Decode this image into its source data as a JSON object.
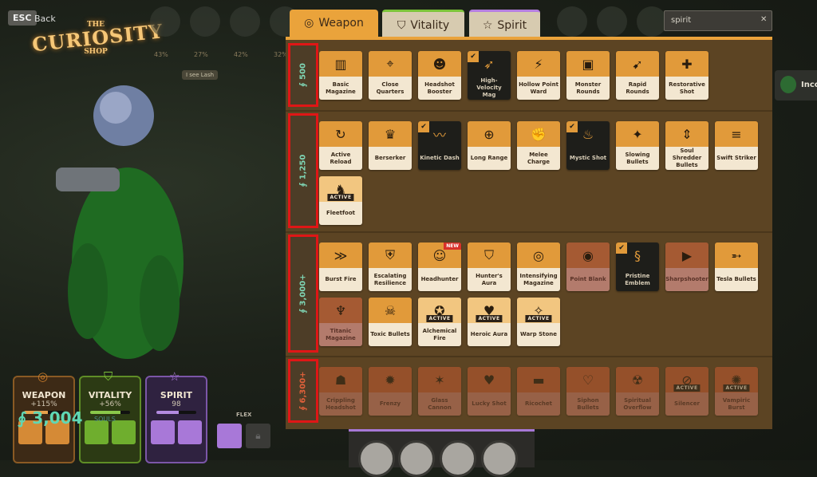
{
  "header": {
    "esc_key": "ESC",
    "back_label": "Back",
    "logo": {
      "the": "THE",
      "name": "CURIOSITY",
      "shop": "SHOP"
    },
    "portrait_percents": [
      "43%",
      "27%",
      "42%",
      "32%"
    ],
    "ping_label": "I see Lash"
  },
  "tabs": [
    {
      "label": "Weapon",
      "icon": "weapon-icon",
      "active": true
    },
    {
      "label": "Vitality",
      "icon": "vitality-icon",
      "active": false
    },
    {
      "label": "Spirit",
      "icon": "spirit-icon",
      "active": false
    }
  ],
  "search": {
    "value": "spirit",
    "clear_icon": "close-icon"
  },
  "notification": {
    "text": "Inco"
  },
  "tiers": [
    {
      "price": "500",
      "locked": false,
      "items": [
        {
          "name": "Basic Magazine",
          "icon": "▥"
        },
        {
          "name": "Close Quarters",
          "icon": "⌖"
        },
        {
          "name": "Headshot Booster",
          "icon": "☻"
        },
        {
          "name": "High-Velocity Mag",
          "icon": "➶",
          "owned": true
        },
        {
          "name": "Hollow Point Ward",
          "icon": "⚡"
        },
        {
          "name": "Monster Rounds",
          "icon": "▣"
        },
        {
          "name": "Rapid Rounds",
          "icon": "➹"
        },
        {
          "name": "Restorative Shot",
          "icon": "✚"
        }
      ]
    },
    {
      "price": "1,250",
      "locked": false,
      "items": [
        {
          "name": "Active Reload",
          "icon": "↻"
        },
        {
          "name": "Berserker",
          "icon": "♛"
        },
        {
          "name": "Kinetic Dash",
          "icon": "〰",
          "owned": true
        },
        {
          "name": "Long Range",
          "icon": "⊕"
        },
        {
          "name": "Melee Charge",
          "icon": "✊"
        },
        {
          "name": "Mystic Shot",
          "icon": "♨",
          "owned": true
        },
        {
          "name": "Slowing Bullets",
          "icon": "✦"
        },
        {
          "name": "Soul Shredder Bullets",
          "icon": "⇕"
        },
        {
          "name": "Swift Striker",
          "icon": "≡"
        },
        {
          "name": "Fleetfoot",
          "icon": "♞",
          "active": true,
          "light": true
        }
      ]
    },
    {
      "price": "3,000+",
      "locked": false,
      "items": [
        {
          "name": "Burst Fire",
          "icon": "≫"
        },
        {
          "name": "Escalating Resilience",
          "icon": "⛨"
        },
        {
          "name": "Headhunter",
          "icon": "☺",
          "new": true
        },
        {
          "name": "Hunter's Aura",
          "icon": "⛉"
        },
        {
          "name": "Intensifying Magazine",
          "icon": "◎"
        },
        {
          "name": "Point Blank",
          "icon": "◉",
          "disabled": true
        },
        {
          "name": "Pristine Emblem",
          "icon": "§",
          "owned": true
        },
        {
          "name": "Sharpshooter",
          "icon": "▶",
          "disabled": true
        },
        {
          "name": "Tesla Bullets",
          "icon": "➵"
        },
        {
          "name": "Titanic Magazine",
          "icon": "♆",
          "disabled": true
        },
        {
          "name": "Toxic Bullets",
          "icon": "☠"
        },
        {
          "name": "Alchemical Fire",
          "icon": "✪",
          "active": true,
          "light": true
        },
        {
          "name": "Heroic Aura",
          "icon": "♥",
          "active": true,
          "light": true
        },
        {
          "name": "Warp Stone",
          "icon": "✧",
          "active": true,
          "light": true
        }
      ]
    },
    {
      "price": "6,300+",
      "locked": true,
      "items": [
        {
          "name": "Crippling Headshot",
          "icon": "☗"
        },
        {
          "name": "Frenzy",
          "icon": "✹"
        },
        {
          "name": "Glass Cannon",
          "icon": "✶"
        },
        {
          "name": "Lucky Shot",
          "icon": "♥"
        },
        {
          "name": "Ricochet",
          "icon": "▬"
        },
        {
          "name": "Siphon Bullets",
          "icon": "♡"
        },
        {
          "name": "Spiritual Overflow",
          "icon": "☢"
        },
        {
          "name": "Silencer",
          "icon": "⊘",
          "active": true
        },
        {
          "name": "Vampiric Burst",
          "icon": "✺",
          "active": true
        }
      ]
    }
  ],
  "labels": {
    "active": "ACTIVE",
    "new": "NEW",
    "check": "✔",
    "soul_glyph": "∮"
  },
  "stats": [
    {
      "name": "WEAPON",
      "value": "+115%",
      "fill": 0.6,
      "color": "#e7a14a"
    },
    {
      "name": "VITALITY",
      "value": "+56%",
      "fill": 0.75,
      "color": "#8ac94a"
    },
    {
      "name": "SPIRIT",
      "value": "98",
      "fill": 0.55,
      "color": "#b38be0"
    }
  ],
  "souls": {
    "value": "3,004",
    "label": "SOULS"
  },
  "flex": {
    "label": "FLEX"
  }
}
